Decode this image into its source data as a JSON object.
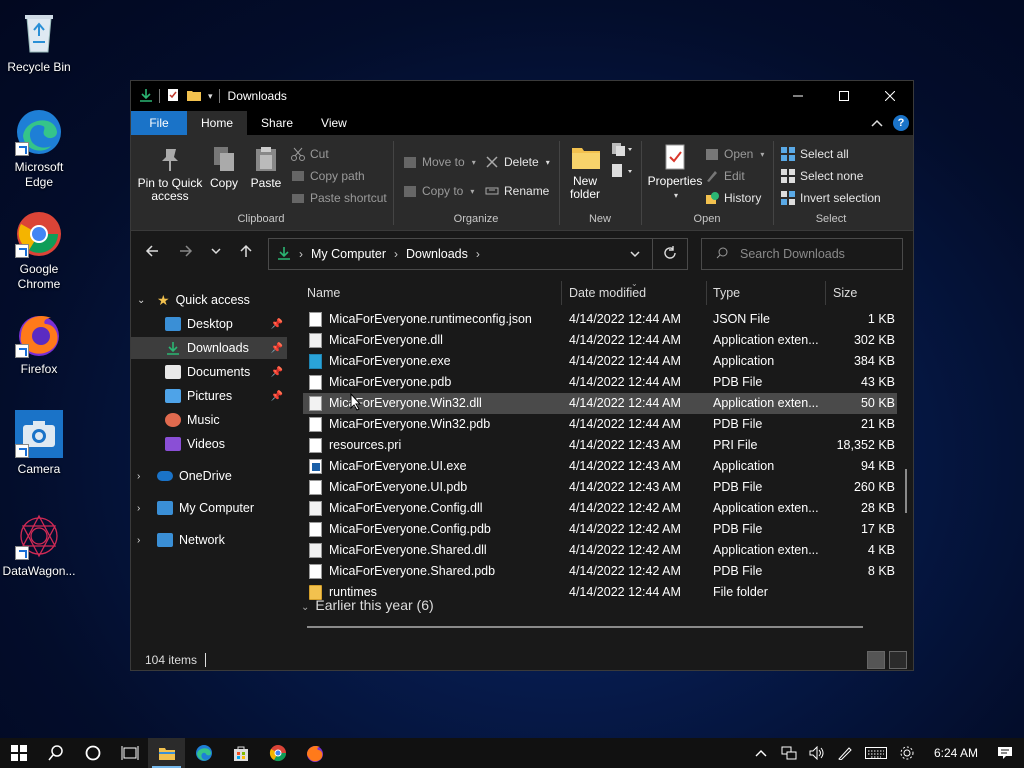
{
  "desktop": {
    "icons": [
      {
        "label": "Recycle Bin",
        "name": "recycle-bin-icon"
      },
      {
        "label": "Microsoft Edge",
        "name": "edge-icon"
      },
      {
        "label": "Google Chrome",
        "name": "chrome-icon"
      },
      {
        "label": "Firefox",
        "name": "firefox-icon"
      },
      {
        "label": "Camera",
        "name": "camera-icon"
      },
      {
        "label": "DataWagon...",
        "name": "datawagon-icon"
      }
    ]
  },
  "window": {
    "title": "Downloads",
    "tabs": [
      "File",
      "Home",
      "Share",
      "View"
    ],
    "active_tab": "Home"
  },
  "ribbon": {
    "clipboard": {
      "label": "Clipboard",
      "pin": "Pin to Quick access",
      "copy": "Copy",
      "paste": "Paste",
      "cut": "Cut",
      "copy_path": "Copy path",
      "paste_shortcut": "Paste shortcut"
    },
    "organize": {
      "label": "Organize",
      "move_to": "Move to",
      "copy_to": "Copy to",
      "delete": "Delete",
      "rename": "Rename"
    },
    "new": {
      "label": "New",
      "new_folder": "New folder"
    },
    "open": {
      "label": "Open",
      "properties": "Properties",
      "open": "Open",
      "edit": "Edit",
      "history": "History"
    },
    "select": {
      "label": "Select",
      "select_all": "Select all",
      "select_none": "Select none",
      "invert": "Invert selection"
    }
  },
  "address": {
    "crumbs": [
      "My Computer",
      "Downloads"
    ],
    "search_placeholder": "Search Downloads"
  },
  "nav": {
    "quick_access": "Quick access",
    "items": [
      "Desktop",
      "Downloads",
      "Documents",
      "Pictures",
      "Music",
      "Videos"
    ],
    "selected": "Downloads",
    "onedrive": "OneDrive",
    "my_computer": "My Computer",
    "network": "Network"
  },
  "columns": {
    "name": "Name",
    "date": "Date modified",
    "type": "Type",
    "size": "Size"
  },
  "files": [
    {
      "name": "MicaForEveryone.runtimeconfig.json",
      "date": "4/14/2022 12:44 AM",
      "type": "JSON File",
      "size": "1 KB",
      "icon": "file"
    },
    {
      "name": "MicaForEveryone.dll",
      "date": "4/14/2022 12:44 AM",
      "type": "Application exten...",
      "size": "302 KB",
      "icon": "dll"
    },
    {
      "name": "MicaForEveryone.exe",
      "date": "4/14/2022 12:44 AM",
      "type": "Application",
      "size": "384 KB",
      "icon": "exe"
    },
    {
      "name": "MicaForEveryone.pdb",
      "date": "4/14/2022 12:44 AM",
      "type": "PDB File",
      "size": "43 KB",
      "icon": "file"
    },
    {
      "name": "MicaForEveryone.Win32.dll",
      "date": "4/14/2022 12:44 AM",
      "type": "Application exten...",
      "size": "50 KB",
      "icon": "dll"
    },
    {
      "name": "MicaForEveryone.Win32.pdb",
      "date": "4/14/2022 12:44 AM",
      "type": "PDB File",
      "size": "21 KB",
      "icon": "file"
    },
    {
      "name": "resources.pri",
      "date": "4/14/2022 12:43 AM",
      "type": "PRI File",
      "size": "18,352 KB",
      "icon": "file"
    },
    {
      "name": "MicaForEveryone.UI.exe",
      "date": "4/14/2022 12:43 AM",
      "type": "Application",
      "size": "94 KB",
      "icon": "exe2"
    },
    {
      "name": "MicaForEveryone.UI.pdb",
      "date": "4/14/2022 12:43 AM",
      "type": "PDB File",
      "size": "260 KB",
      "icon": "file"
    },
    {
      "name": "MicaForEveryone.Config.dll",
      "date": "4/14/2022 12:42 AM",
      "type": "Application exten...",
      "size": "28 KB",
      "icon": "dll"
    },
    {
      "name": "MicaForEveryone.Config.pdb",
      "date": "4/14/2022 12:42 AM",
      "type": "PDB File",
      "size": "17 KB",
      "icon": "file"
    },
    {
      "name": "MicaForEveryone.Shared.dll",
      "date": "4/14/2022 12:42 AM",
      "type": "Application exten...",
      "size": "4 KB",
      "icon": "dll"
    },
    {
      "name": "MicaForEveryone.Shared.pdb",
      "date": "4/14/2022 12:42 AM",
      "type": "PDB File",
      "size": "8 KB",
      "icon": "file"
    },
    {
      "name": "runtimes",
      "date": "4/14/2022 12:44 AM",
      "type": "File folder",
      "size": "",
      "icon": "folder"
    }
  ],
  "group_header": "Earlier this year (6)",
  "status": {
    "items": "104 items"
  },
  "taskbar": {
    "time": "6:24 AM"
  }
}
